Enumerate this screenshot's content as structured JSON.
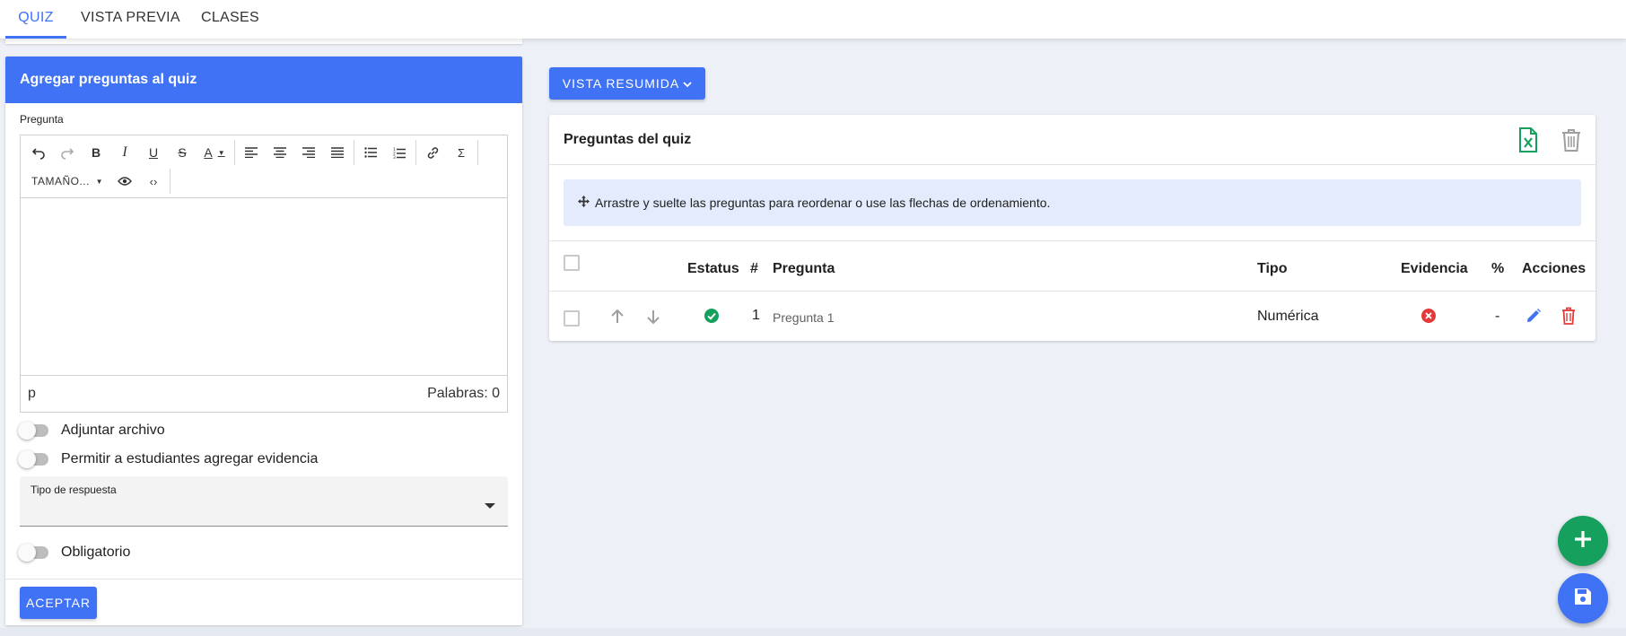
{
  "tabs": [
    {
      "label": "QUIZ",
      "active": true
    },
    {
      "label": "VISTA PREVIA",
      "active": false
    },
    {
      "label": "CLASES",
      "active": false
    }
  ],
  "left_panel": {
    "header": "Agregar preguntas al quiz",
    "question_label": "Pregunta",
    "editor": {
      "size_label": "TAMAÑO...",
      "path": "p",
      "word_count": "Palabras: 0"
    },
    "attach_file_label": "Adjuntar archivo",
    "allow_evidence_label": "Permitir a estudiantes agregar evidencia",
    "answer_type_label": "Tipo de respuesta",
    "answer_type_value": "",
    "mandatory_label": "Obligatorio",
    "accept_label": "ACEPTAR"
  },
  "summary_button": {
    "label": "VISTA RESUMIDA"
  },
  "questions_card": {
    "title": "Preguntas del quiz",
    "info_text": "Arrastre y suelte las preguntas para reordenar o use las flechas de ordenamiento.",
    "columns": {
      "status": "Estatus",
      "number": "#",
      "question": "Pregunta",
      "type": "Tipo",
      "evidence": "Evidencia",
      "percent": "%",
      "actions": "Acciones"
    },
    "rows": [
      {
        "number": "1",
        "question": "Pregunta 1",
        "type": "Numérica",
        "percent": "-",
        "status": "ok",
        "evidence": "no"
      }
    ]
  },
  "colors": {
    "primary": "#3f72f5",
    "success": "#16a05d",
    "danger": "#e53935",
    "info_bg": "#e3ebfc"
  }
}
